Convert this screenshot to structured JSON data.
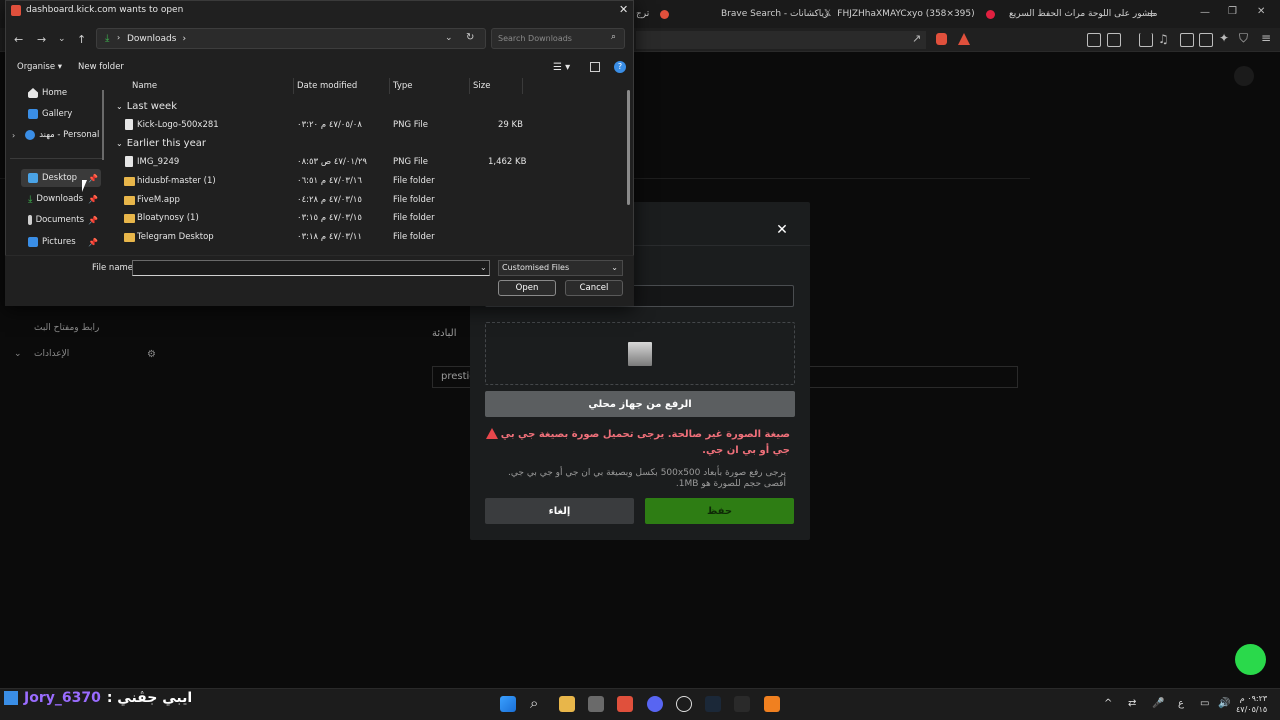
{
  "browser": {
    "tabs": [
      {
        "label": "Brave Search - رياكشانات"
      },
      {
        "label": "FHJZHhaXMAYCxyo (358×395)"
      },
      {
        "label": "منشور على اللوحة مراث الحفظ السريع"
      }
    ],
    "tab_partial": "ترج"
  },
  "dialog": {
    "title": "dashboard.kick.com wants to open",
    "close_glyph": "✕",
    "breadcrumb": "Downloads",
    "search_placeholder": "Search Downloads",
    "organise_label": "Organise ▾",
    "new_folder_label": "New folder",
    "nav_items": [
      {
        "label": "Home",
        "pinned": false
      },
      {
        "label": "Gallery",
        "pinned": false
      },
      {
        "label": "مهند - Personal",
        "pinned": false
      },
      {
        "label": "Desktop",
        "pinned": true
      },
      {
        "label": "Downloads",
        "pinned": true
      },
      {
        "label": "Documents",
        "pinned": true
      },
      {
        "label": "Pictures",
        "pinned": true
      }
    ],
    "columns": {
      "name": "Name",
      "date": "Date modified",
      "type": "Type",
      "size": "Size"
    },
    "groups": [
      {
        "label": "Last week"
      },
      {
        "label": "Earlier this year"
      }
    ],
    "files": [
      {
        "name": "Kick-Logo-500x281",
        "date": "٤٧/٠٥/٠٨ م ٠٣:٢٠",
        "type": "PNG File",
        "size": "29 KB",
        "kind": "file"
      },
      {
        "name": "IMG_9249",
        "date": "٤٧/٠١/٢٩ ص ٠٨:٥٣",
        "type": "PNG File",
        "size": "1,462 KB",
        "kind": "file"
      },
      {
        "name": "hidusbf-master (1)",
        "date": "٤٧/٠٣/١٦ م ٠٦:٥١",
        "type": "File folder",
        "size": "",
        "kind": "folder"
      },
      {
        "name": "FiveM.app",
        "date": "٤٧/٠٣/١٥ م ٠٤:٢٨",
        "type": "File folder",
        "size": "",
        "kind": "folder"
      },
      {
        "name": "Bloatynosy (1)",
        "date": "٤٧/٠٣/١٥ م ٠٣:١٥",
        "type": "File folder",
        "size": "",
        "kind": "folder"
      },
      {
        "name": "Telegram Desktop",
        "date": "٤٧/٠٣/١١ م ٠٣:١٨",
        "type": "File folder",
        "size": "",
        "kind": "folder"
      }
    ],
    "file_name_label": "File name:",
    "file_name_value": "",
    "file_type": "Customised Files",
    "open_label": "Open",
    "cancel_label": "Cancel"
  },
  "page": {
    "sidebar": {
      "item1": "رابط ومفتاح البث",
      "item2": "الإعدادات"
    },
    "bg_label": "البادئة",
    "bg_input": "prestig",
    "modal": {
      "close_glyph": "✕",
      "upload_label": "الرفع من جهاز محلي",
      "error_text": "صيغة الصورة غير صالحة. يرجى تحميل صورة بصيغة جي بي جي أو بي ان جي.",
      "hint_text": "يرجى رفع صورة بأبعاد 500x500 بكسل وبصيغة بي ان جي أو جي بي جي. أقصى حجم للصورة هو 1MB.",
      "cancel_label": "إلغاء",
      "save_label": "حفظ"
    }
  },
  "taskbar": {
    "overlay_prefix": "ايبي جڤني :",
    "overlay_user": "Jory_6370",
    "time": "٠٩:٢٣ م",
    "date": "٤٧/٠٥/١٥",
    "lang": "ع"
  },
  "colors": {
    "accent_green": "#2e7d14",
    "error": "#f0707a",
    "folder": "#e8b64a"
  }
}
